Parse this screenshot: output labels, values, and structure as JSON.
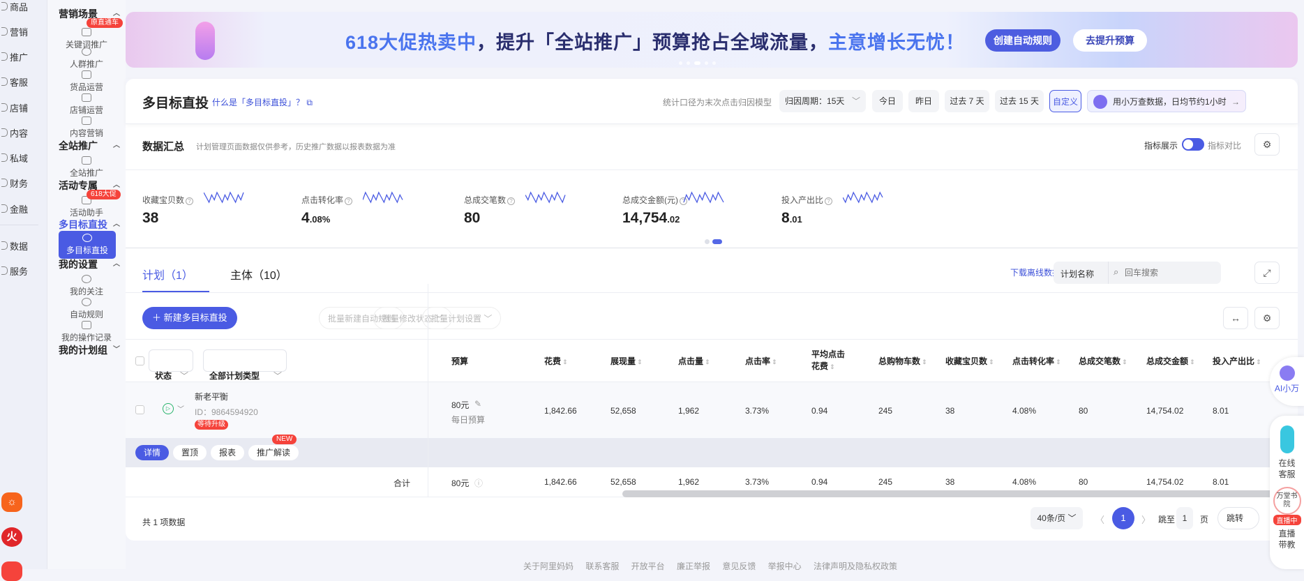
{
  "rail": {
    "items": [
      "商品",
      "营销",
      "推广",
      "客服",
      "店铺",
      "内容",
      "私域",
      "财务",
      "金融",
      "数据",
      "服务"
    ]
  },
  "sidebar": {
    "groups": [
      {
        "title": "营销场景",
        "items": [
          {
            "label": "关键词推广",
            "tag": "原直通车"
          },
          {
            "label": "人群推广"
          },
          {
            "label": "货品运营"
          },
          {
            "label": "店铺运营"
          },
          {
            "label": "内容营销"
          }
        ]
      },
      {
        "title": "全站推广",
        "items": [
          {
            "label": "全站推广"
          }
        ]
      },
      {
        "title": "活动专属",
        "items": [
          {
            "label": "活动助手",
            "tag": "618大促"
          }
        ]
      },
      {
        "title": "多目标直投",
        "items": [
          {
            "label": "多目标直投"
          }
        ]
      },
      {
        "title": "我的设置",
        "items": [
          {
            "label": "我的关注"
          },
          {
            "label": "自动规则"
          },
          {
            "label": "我的操作记录"
          }
        ]
      },
      {
        "title": "我的计划组"
      }
    ]
  },
  "banner": {
    "part1": "618大促热卖中",
    "part2": "，提升「全站推广」预算抢占全域流量，",
    "part3": "主意增长无忧！",
    "btn_create": "创建自动规则",
    "btn_raise": "去提升预算"
  },
  "header": {
    "title": "多目标直投",
    "help_link": "什么是「多目标直投」？",
    "note": "统计口径为末次点击归因模型",
    "period_label": "归因周期：",
    "period_value": "15天",
    "ranges": [
      "今日",
      "昨日",
      "过去 7 天",
      "过去 15 天",
      "自定义"
    ],
    "ai_banner": "用小万查数据，日均节约1小时"
  },
  "summary": {
    "title": "数据汇总",
    "note": "计划管理页面数据仅供参考，历史推广数据以报表数据为准",
    "toggle_label": "指标展示",
    "compare_label": "指标对比",
    "metrics": [
      {
        "label": "收藏宝贝数",
        "int": "38",
        "dec": ""
      },
      {
        "label": "点击转化率",
        "int": "4",
        "dec": ".08%"
      },
      {
        "label": "总成交笔数",
        "int": "80",
        "dec": ""
      },
      {
        "label": "总成交金额(元)",
        "int": "14,754",
        "dec": ".02"
      },
      {
        "label": "投入产出比",
        "int": "8",
        "dec": ".01"
      }
    ]
  },
  "tabs": [
    {
      "label": "计划（1）",
      "active": true
    },
    {
      "label": "主体（10）"
    }
  ],
  "toolbar": {
    "download": "下载离线数据 〉",
    "search_field": "计划名称",
    "search_placeholder": "回车搜索",
    "new_btn": "新建多目标直投",
    "batch_rule": "批量新建自动规则",
    "batch_status": "批量修改状态",
    "batch_setting": "批量计划设置"
  },
  "table": {
    "filter_status": "状态",
    "filter_type": "全部计划类型",
    "columns": [
      "预算",
      "花费",
      "展现量",
      "点击量",
      "点击率",
      "平均点击花费",
      "总购物车数",
      "收藏宝贝数",
      "点击转化率",
      "总成交笔数",
      "总成交金额",
      "投入产出比"
    ],
    "row": {
      "name": "新老平衡",
      "id": "ID：9864594920",
      "badge": "等待升级",
      "budget": "80元",
      "budget_type": "每日预算",
      "values": [
        "1,842.66",
        "52,658",
        "1,962",
        "3.73%",
        "0.94",
        "245",
        "38",
        "4.08%",
        "80",
        "14,754.02",
        "8.01"
      ]
    },
    "actions": [
      "详情",
      "置顶",
      "报表",
      "推广解读"
    ],
    "new_badge": "NEW",
    "total": {
      "label": "合计",
      "budget": "80元",
      "values": [
        "1,842.66",
        "52,658",
        "1,962",
        "3.73%",
        "0.94",
        "245",
        "38",
        "4.08%",
        "80",
        "14,754.02",
        "8.01"
      ]
    }
  },
  "pagination": {
    "total": "共 1 项数据",
    "page_size": "40条/页",
    "current": "1",
    "jump_label": "跳至",
    "jump_value": "1",
    "page_unit": "页",
    "jump_btn": "跳转"
  },
  "float": {
    "ai": "AI小万",
    "service": "在线客服",
    "academy": "万堂书院",
    "live_tag": "直播中",
    "live": "直播带教"
  },
  "footer": "关于阿里妈妈 联系客服 开放平台 廉正举报 意见反馈 举报中心 法律声明及隐私权政策",
  "colors": {
    "primary": "#4a5be3",
    "danger": "#f5433b"
  }
}
